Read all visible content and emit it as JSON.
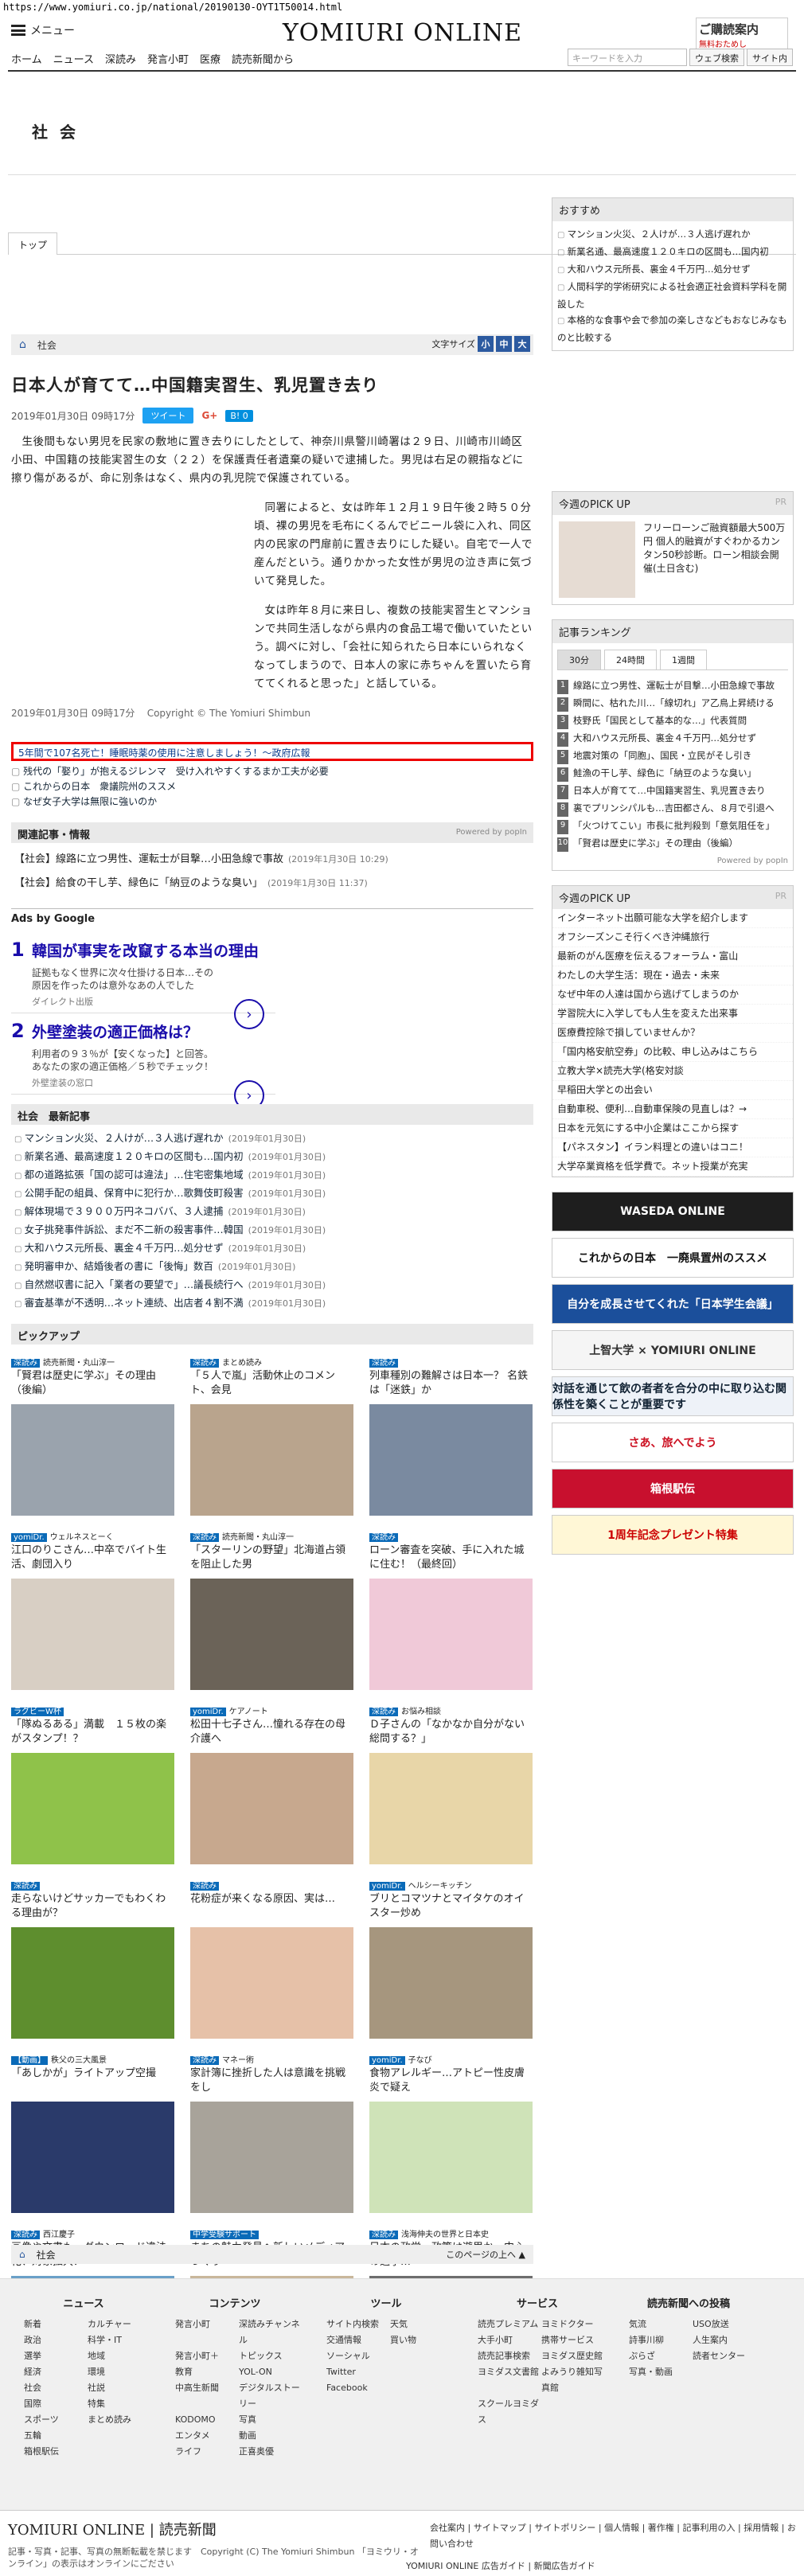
{
  "url": "https://www.yomiuri.co.jp/national/20190130-OYT1T50014.html",
  "header": {
    "menu_label": "メニュー",
    "logo": "YOMIURI ONLINE",
    "subs_title": "ご購読案内",
    "subs_sub": "無料おためし",
    "nav": [
      "ホーム",
      "ニュース",
      "深読み",
      "発言小町",
      "医療",
      "読売新聞から"
    ],
    "search_placeholder": "キーワードを入力",
    "search_web": "ウェブ検索",
    "search_site": "サイト内"
  },
  "section": {
    "title": "社 会",
    "tab": "トップ"
  },
  "breadcrumb": {
    "home": "⌂",
    "section": "社会"
  },
  "fontsize": {
    "label": "文字サイズ",
    "s": "小",
    "m": "中",
    "l": "大"
  },
  "article": {
    "title": "日本人が育てて…中国籍実習生、乳児置き去り",
    "date": "2019年01月30日 09時17分",
    "tweet": "ツイート",
    "gplus": "G+",
    "hatena": "B! 0",
    "p1": "生後間もない男児を民家の敷地に置き去りにしたとして、神奈川県警川崎署は２９日、川崎市川崎区小田、中国籍の技能実習生の女（２２）を保護責任者遺棄の疑いで逮捕した。男児は右足の親指などに擦り傷があるが、命に別条はなく、県内の乳児院で保護されている。",
    "p2": "同署によると、女は昨年１２月１９日午後２時５０分頃、裸の男児を毛布にくるんでビニール袋に入れ、同区内の民家の門扉前に置き去りにした疑い。自宅で一人で産んだという。通りかかった女性が男児の泣き声に気づいて発見した。",
    "p3": "女は昨年８月に来日し、複数の技能実習生とマンションで共同生活しながら県内の食品工場で働いていたという。調べに対し、「会社に知られたら日本にいられなくなってしまうので、日本人の家に赤ちゃんを置いたら育ててくれると思った」と話している。",
    "footer_date": "2019年01月30日 09時17分",
    "copyright": "Copyright © The Yomiuri Shimbun"
  },
  "promo": {
    "red": "5年間で107名死亡！睡眠時薬の使用に注意しましょう！～政府広報",
    "items": [
      "残代の「娶り」が抱えるジレンマ　受け入れやすくするまか工夫が必要",
      "これからの日本　衆議院州のススメ",
      "なぜ女子大学は無限に強いのか"
    ]
  },
  "related": {
    "title": "関連記事・情報",
    "powered": "Powered by popIn",
    "items": [
      {
        "t": "【社会】線路に立つ男性、運転士が目撃…小田急線で事故",
        "d": "(2019年1月30日 10:29)"
      },
      {
        "t": "【社会】給食の干し芋、緑色に「納豆のような臭い」",
        "d": "(2019年1月30日 11:37)"
      }
    ]
  },
  "ads": {
    "label": "Ads by Google",
    "items": [
      {
        "n": "1",
        "h": "韓国が事実を改竄する本当の理由",
        "d": "証拠もなく世界に次々仕掛ける日本…その原因を作ったのは意外なあの人でした",
        "s": "ダイレクト出版"
      },
      {
        "n": "2",
        "h": "外壁塗装の適正価格は？",
        "d": "利用者の９３％が【安くなった】と回答。あなたの家の適正価格／５秒でチェック！",
        "s": "外壁塗装の窓口"
      }
    ]
  },
  "latest": {
    "title": "社会　最新記事",
    "items": [
      {
        "t": "マンション火災、２人けが…３人逃げ遅れか",
        "d": "(2019年01月30日)"
      },
      {
        "t": "新業名通、最高速度１２０キロの区間も…国内初",
        "d": "(2019年01月30日)"
      },
      {
        "t": "都の道路拡張「国の認可は違法」…住宅密集地域",
        "d": "(2019年01月30日)"
      },
      {
        "t": "公開手配の組員、保育中に犯行か…歌舞伎町殺害",
        "d": "(2019年01月30日)"
      },
      {
        "t": "解体現場で３９００万円ネコババ、３人逮捕",
        "d": "(2019年01月30日)"
      },
      {
        "t": "女子挑発事件訴訟、まだ不二新の殺害事件…韓国",
        "d": "(2019年01月30日)"
      },
      {
        "t": "大和ハウス元所長、裏金４千万円…処分せず",
        "d": "(2019年01月30日)"
      },
      {
        "t": "発明審申か、結婚後者の書に「後悔」数百",
        "d": "(2019年01月30日)"
      },
      {
        "t": "自然燃収書に記入「業者の要望で」…議長続行へ",
        "d": "(2019年01月30日)"
      },
      {
        "t": "審査基準が不透明…ネット連続、出店者４割不満",
        "d": "(2019年01月30日)"
      }
    ]
  },
  "pickup": {
    "title": "ピックアップ",
    "items": [
      {
        "tag": "深読み",
        "sub": "読売新聞・丸山淳一",
        "t": "「賢君は歴史に学ぶ」その理由（後編）",
        "c": "#9aa3ad"
      },
      {
        "tag": "深読み",
        "sub": "まとめ読み",
        "t": "「５人で嵐」活動休止のコメント、会見",
        "c": "#b9a48d"
      },
      {
        "tag": "深読み",
        "sub": "",
        "t": "列車種別の難解さは日本一？ 名鉄は「迷鉄」か",
        "c": "#7a8aa0"
      },
      {
        "tag": "yomiDr.",
        "sub": "ウェルネスとーく",
        "t": "江口のりこさん…中卒でバイト生活、劇団入り",
        "c": "#d8cfc4"
      },
      {
        "tag": "深読み",
        "sub": "読売新聞・丸山淳一",
        "t": "「スターリンの野望」北海道占領を阻止した男",
        "c": "#6b6358"
      },
      {
        "tag": "深読み",
        "sub": "",
        "t": "ローン審査を突破、手に入れた城に住む！（最終回）",
        "c": "#f0c9d8"
      },
      {
        "tag": "ラグビーW杯",
        "sub": "",
        "t": "「隊ぬるある」満載　１５枚の楽がスタンプ！？",
        "c": "#8fc24a"
      },
      {
        "tag": "yomiDr.",
        "sub": "ケアノート",
        "t": "松田十七子さん…憧れる存在の母 介護へ",
        "c": "#c7a88e"
      },
      {
        "tag": "深読み",
        "sub": "お悩み相談",
        "t": "Ｄ子さんの「なかなか自分がない総問する？」",
        "c": "#e8d6a8"
      },
      {
        "tag": "深読み",
        "sub": "",
        "t": "走らないけどサッカーでもわくわる理由が？",
        "c": "#5e8e2e"
      },
      {
        "tag": "深読み",
        "sub": "",
        "t": "花粉症が来くなる原因、実は…",
        "c": "#e6c1a8"
      },
      {
        "tag": "yomiDr.",
        "sub": "ヘルシーキッチン",
        "t": "ブリとコマツナとマイタケのオイスター炒め",
        "c": "#a6967e"
      },
      {
        "tag": "【動画】",
        "sub": "秩父の三大風景",
        "t": "「あしかが」ライトアップ空撮",
        "c": "#2a3a6a"
      },
      {
        "tag": "深読み",
        "sub": "マネー術",
        "t": "家計簿に挫折した人は意識を挑戦をし",
        "c": "#a8a39a"
      },
      {
        "tag": "yomiDr.",
        "sub": "子なび",
        "t": "食物アレルギー…アトピー性皮膚炎で疑え",
        "c": "#cfe3b8"
      },
      {
        "tag": "深読み",
        "sub": "西江慶子",
        "t": "画像や文書も…ダウンロード違法化、対象拡大？",
        "c": "#6aa0c8"
      },
      {
        "tag": "中学受験サポート",
        "sub": "",
        "t": "まちの魅力発見へ新しいメディアづくり",
        "c": "#c9b79b"
      },
      {
        "tag": "深読み",
        "sub": "浅海伸夫の世界と日本史",
        "t": "日本の政党…政策は遊里か～中心の選挙…",
        "c": "#6d6d6d"
      }
    ]
  },
  "pagefoot": {
    "home": "⌂",
    "section": "社会",
    "up": "このページの上へ ▲"
  },
  "sidebar": {
    "rec_title": "おすすめ",
    "rec": [
      "マンション火災、２人けが…３人逃げ遅れか",
      "新業名通、最高速度１２０キロの区間も…国内初",
      "大和ハウス元所長、裏金４千万円…処分せず",
      "人間科学的学術研究による社会適正社会資料学科を開設した",
      "本格的な食事や会で参加の楽しさなどもおなじみなものと比較する"
    ],
    "pick_title": "今週のPICK UP",
    "pr": "PR",
    "pick_text": "フリーローンご融資額最大500万円 個人的融資がすぐわかるカンタン50秒診断。ローン相談会開催(土日含む)",
    "rank_title": "記事ランキング",
    "rank_tabs": [
      "30分",
      "24時間",
      "1週間"
    ],
    "rank": [
      "線路に立つ男性、運転士が目撃…小田急線で事故",
      "瞬間に、枯れた川…「線切れ」ア乙鳥上昇続ける",
      "枝野氏「国民として基本的な…」代表質問",
      "大和ハウス元所長、裏金４千万円…処分せず",
      "地震対策の「同胞」、国民・立民がそし引き",
      "鮭漁の干し芋、緑色に「納豆のような臭い」",
      "日本人が育てて…中国籍実習生、乳児置き去り",
      "裏でプリンシパルも…吉田都さん、８月で引退へ",
      "「火つけてこい」市長に批判殺到「意気阻任を」",
      "「賢君は歴史に学ぶ」その理由（後編）"
    ],
    "powered": "Powered by popIn",
    "pick2_title": "今週のPICK UP",
    "pick2": [
      "インターネット出願可能な大学を紹介します",
      "オフシーズンこそ行くべき沖縄旅行",
      "最新のがん医療を伝えるフォーラム・富山",
      "わたしの大学生活：現在・過去・未来",
      "なぜ中年の人達は国から逃げてしまうのか",
      "学習院大に入学しても人生を変えた出来事",
      "医療費控除で損していませんか？",
      "「国内格安航空券」の比較、申し込みはこちら",
      "立教大学×読売大学(格安対談",
      "早稲田大学との出会い",
      "自動車税、便利…自動車保険の見直しは？→",
      "日本を元気にする中小企業はここから探す",
      "【パネスタン】イラン料理との違いはコニ！",
      "大学卒業資格を低学費で。ネット授業が充実"
    ],
    "banners": [
      {
        "t": "WASEDA ONLINE",
        "bg": "#1e1e1e",
        "fg": "#fff"
      },
      {
        "t": "これからの日本　一廃県置州のススメ",
        "bg": "#fff",
        "fg": "#111"
      },
      {
        "t": "自分を成長させてくれた「日本学生会議」",
        "bg": "#1b4f9b",
        "fg": "#fff"
      },
      {
        "t": "上智大学 × YOMIURI ONLINE",
        "bg": "#f5f5f5",
        "fg": "#333"
      },
      {
        "t": "対話を通じて飲の者者を合分の中に取り込む関係性を築くことが重要です",
        "bg": "#eef2f8",
        "fg": "#123"
      },
      {
        "t": "さあ、旅へでよう",
        "bg": "#fff",
        "fg": "#c12"
      },
      {
        "t": "箱根駅伝",
        "bg": "#c8102e",
        "fg": "#fff"
      },
      {
        "t": "1周年記念プレゼント特集",
        "bg": "#fff7d6",
        "fg": "#c00"
      }
    ]
  },
  "footer": {
    "cols": [
      {
        "h": "ニュース",
        "items": [
          "新着",
          "カルチャー",
          "政治",
          "科学・IT",
          "選挙",
          "地域",
          "経済",
          "環境",
          "社会",
          "社説",
          "国際",
          "特集",
          "スポーツ",
          "まとめ読み",
          "五輪",
          "",
          "箱根駅伝",
          ""
        ]
      },
      {
        "h": "コンテンツ",
        "items": [
          "発言小町",
          "深読みチャンネル",
          "発言小町＋",
          "トピックス",
          "教育",
          "YOL-ON",
          "中高生新聞",
          "デジタルストーリー",
          "KODOMO",
          "写真",
          "エンタメ",
          "動画",
          "ライフ",
          "正喜奥優"
        ]
      },
      {
        "h": "ツール",
        "items": [
          "サイト内検索",
          "天気",
          "交通情報",
          "買い物",
          "",
          "",
          "ソーシャル",
          "",
          "Twitter",
          "",
          "Facebook",
          ""
        ]
      },
      {
        "h": "サービス",
        "items": [
          "読売プレミアム",
          "ヨミドクター",
          "大手小町",
          "携帯サービス",
          "読売記事検索",
          "ヨミダス歴史館",
          "ヨミダス文書館",
          "よみうり雑知写真館",
          "スクールヨミダス"
        ]
      },
      {
        "h": "読売新聞への投稿",
        "items": [
          "気流",
          "USO放送",
          "詩事川柳",
          "人生案内",
          "ぷらざ",
          "読者センター",
          "写真・動画"
        ]
      }
    ],
    "logo": "YOMIURI ONLINE | 読売新聞",
    "copy": "記事・写真・記事、写真の無断転載を禁じます　Copyright (C) The Yomiuri Shimbun\n「ヨミウリ・オンライン」の表示はオンラインにごださい",
    "links": "会社案内 | サイトマップ | サイトポリシー | 個人情報 | 著作権 | 記事利用の入 | 採用情報 | お問い合わせ",
    "bottom": "YOMIURI ONLINE 広告ガイド | 新聞広告ガイド"
  }
}
